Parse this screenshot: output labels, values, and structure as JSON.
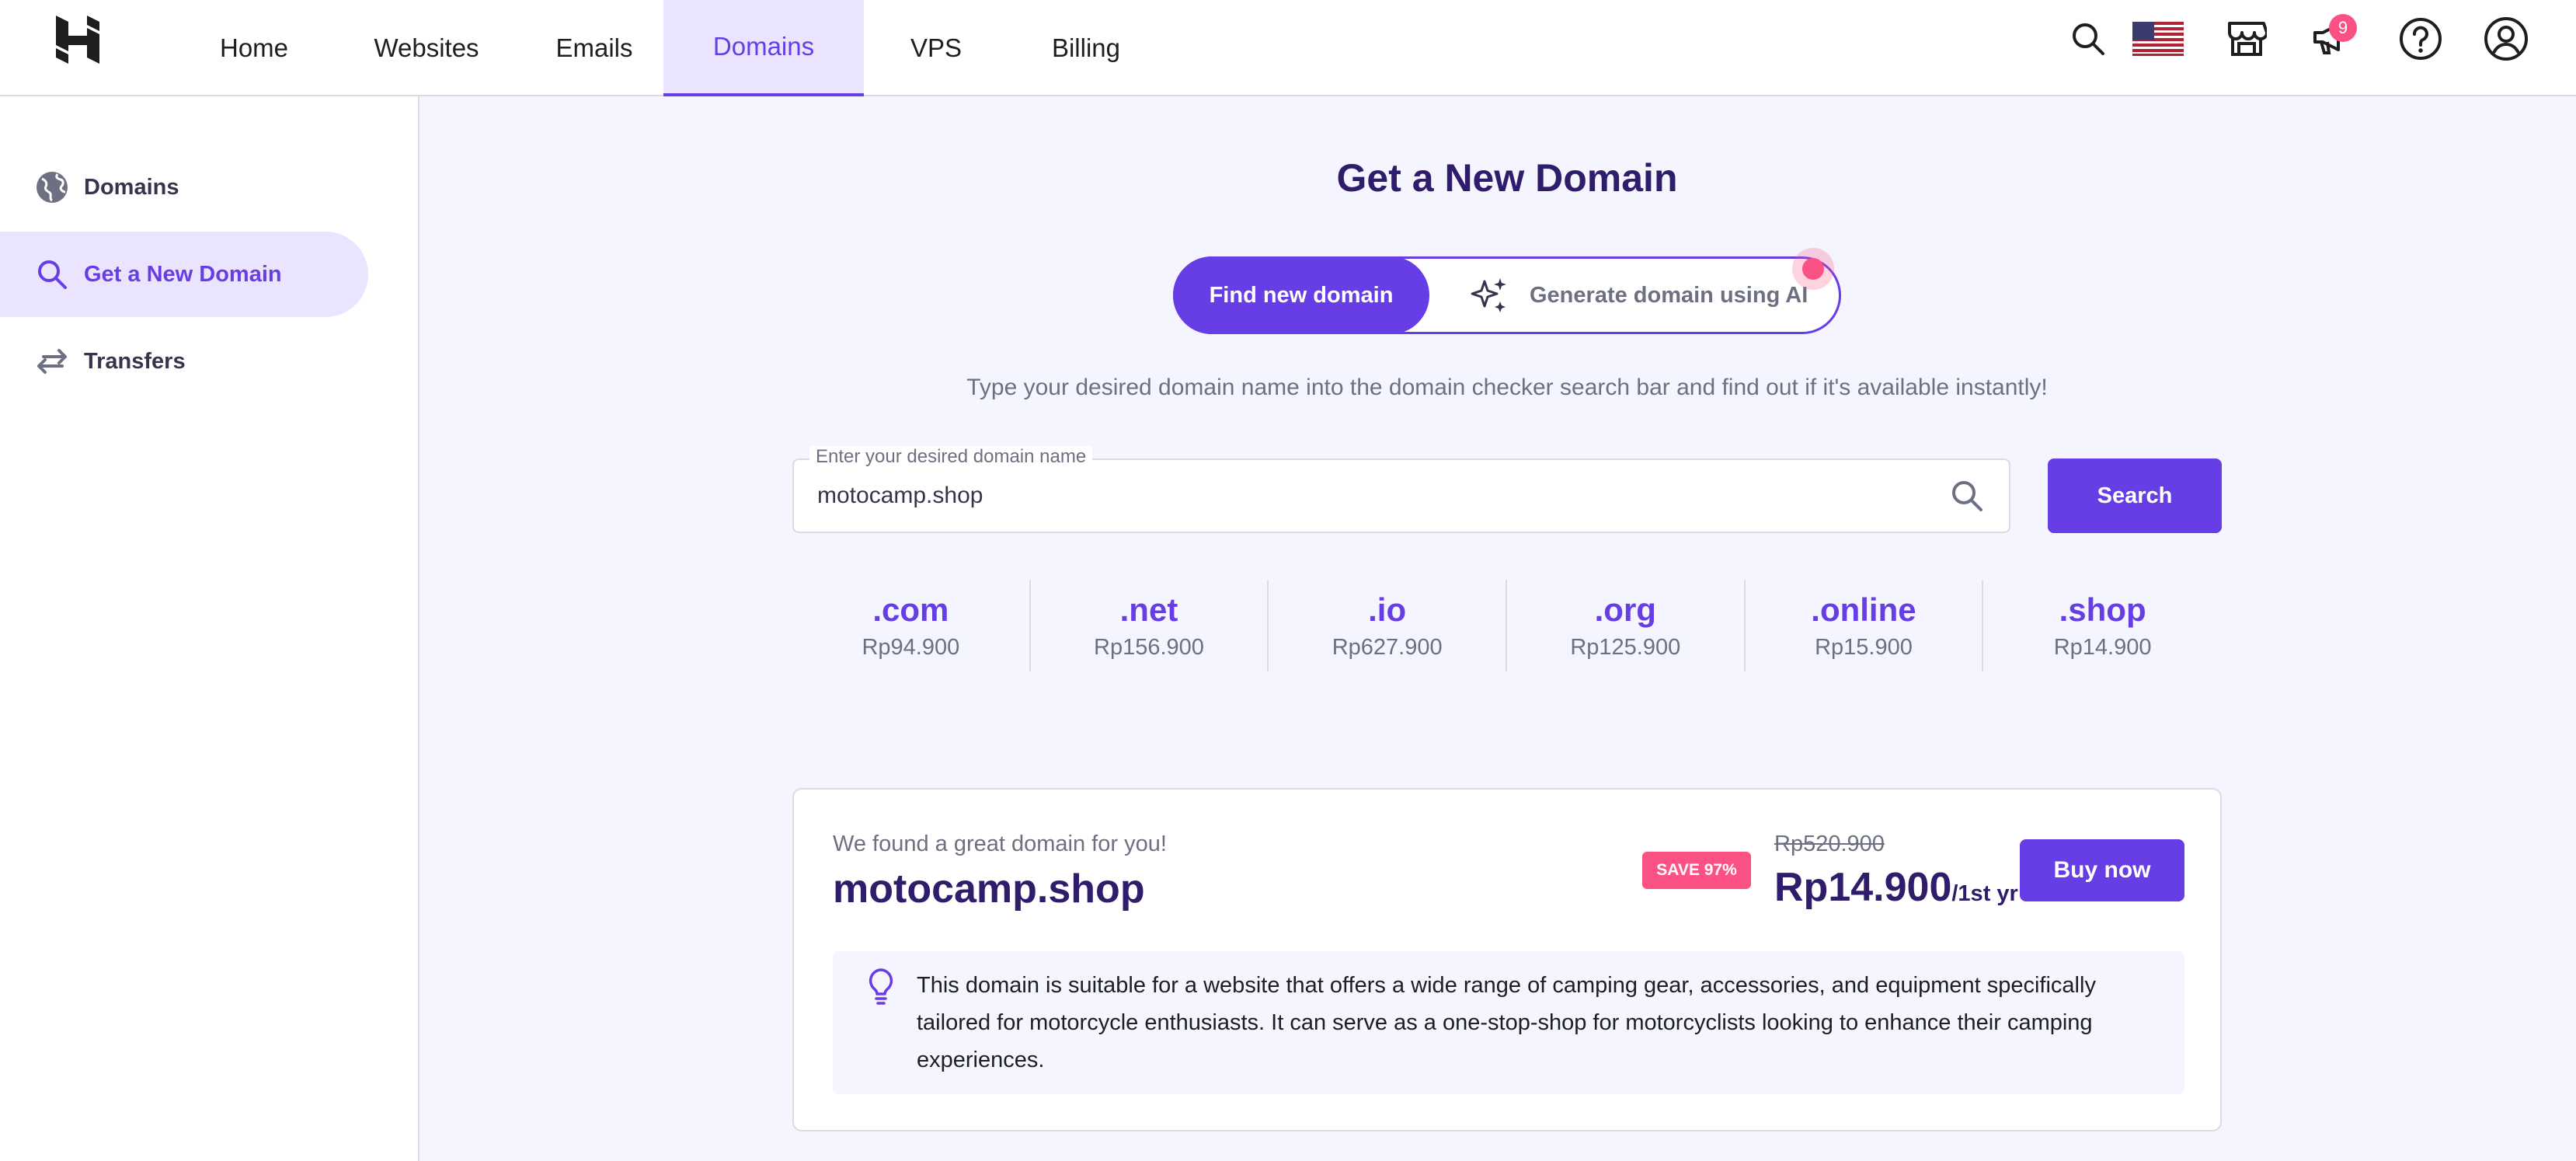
{
  "nav": {
    "items": [
      {
        "label": "Home"
      },
      {
        "label": "Websites"
      },
      {
        "label": "Emails"
      },
      {
        "label": "Domains",
        "active": true
      },
      {
        "label": "VPS"
      },
      {
        "label": "Billing"
      }
    ],
    "notification_count": "9",
    "icons": [
      "search-icon",
      "us-flag-icon",
      "store-icon",
      "megaphone-icon",
      "help-icon",
      "account-icon"
    ]
  },
  "sidebar": {
    "items": [
      {
        "label": "Domains",
        "icon": "globe-icon"
      },
      {
        "label": "Get a New Domain",
        "icon": "search-icon",
        "active": true
      },
      {
        "label": "Transfers",
        "icon": "transfer-arrows-icon"
      }
    ]
  },
  "main": {
    "title": "Get a New Domain",
    "toggle": {
      "find_label": "Find new domain",
      "ai_label": "Generate domain using AI"
    },
    "subtitle": "Type your desired domain name into the domain checker search bar and find out if it's available instantly!",
    "search": {
      "label": "Enter your desired domain name",
      "value": "motocamp.shop",
      "button": "Search"
    },
    "tlds": [
      {
        "name": ".com",
        "price": "Rp94.900"
      },
      {
        "name": ".net",
        "price": "Rp156.900"
      },
      {
        "name": ".io",
        "price": "Rp627.900"
      },
      {
        "name": ".org",
        "price": "Rp125.900"
      },
      {
        "name": ".online",
        "price": "Rp15.900"
      },
      {
        "name": ".shop",
        "price": "Rp14.900"
      }
    ]
  },
  "result": {
    "found_text": "We found a great domain for you!",
    "domain": "motocamp.shop",
    "save_badge": "SAVE 97%",
    "old_price": "Rp520.900",
    "price": "Rp14.900",
    "period": "/1st yr",
    "buy_label": "Buy now",
    "description": "This domain is suitable for a website that offers a wide range of camping gear, accessories, and equipment specifically tailored for motorcycle enthusiasts. It can serve as a one-stop-shop for motorcyclists looking to enhance their camping experiences."
  },
  "colors": {
    "accent": "#673de6",
    "accent_light": "#ebe4ff",
    "pink": "#fc5185",
    "text_dark": "#2f1c6a",
    "muted": "#6d7081",
    "background": "#f4f5ff"
  }
}
